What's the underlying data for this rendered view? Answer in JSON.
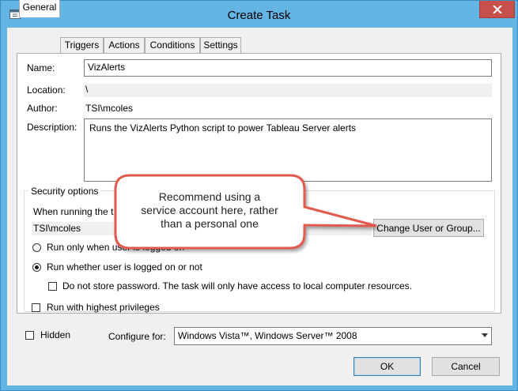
{
  "window": {
    "title": "Create Task"
  },
  "tabs": [
    "General",
    "Triggers",
    "Actions",
    "Conditions",
    "Settings"
  ],
  "general": {
    "name_label": "Name:",
    "name_value": "VizAlerts",
    "location_label": "Location:",
    "location_value": "\\",
    "author_label": "Author:",
    "author_value": "TSI\\mcoles",
    "description_label": "Description:",
    "description_value": "Runs the VizAlerts Python script to power Tableau Server alerts"
  },
  "security": {
    "title": "Security options",
    "running_as_label": "When running the t",
    "user_value": "TSI\\mcoles",
    "change_user_button": "Change User or Group...",
    "run_only_logged_on": "Run only when user is logged on",
    "run_whether_logged_on": "Run whether user is logged on or not",
    "do_not_store_password": "Do not store password.  The task will only have access to local computer resources.",
    "highest_privileges": "Run with highest privileges"
  },
  "bottom": {
    "hidden_label": "Hidden",
    "configure_label": "Configure for:",
    "configure_value": "Windows Vista™, Windows Server™ 2008",
    "ok_button": "OK",
    "cancel_button": "Cancel"
  },
  "callout": {
    "line1": "Recommend using a",
    "line2": "service account here, rather",
    "line3": "than a personal one"
  },
  "colors": {
    "callout_border": "#e05a4e",
    "titlebar": "#64b4e4",
    "close_button": "#c7514a"
  }
}
